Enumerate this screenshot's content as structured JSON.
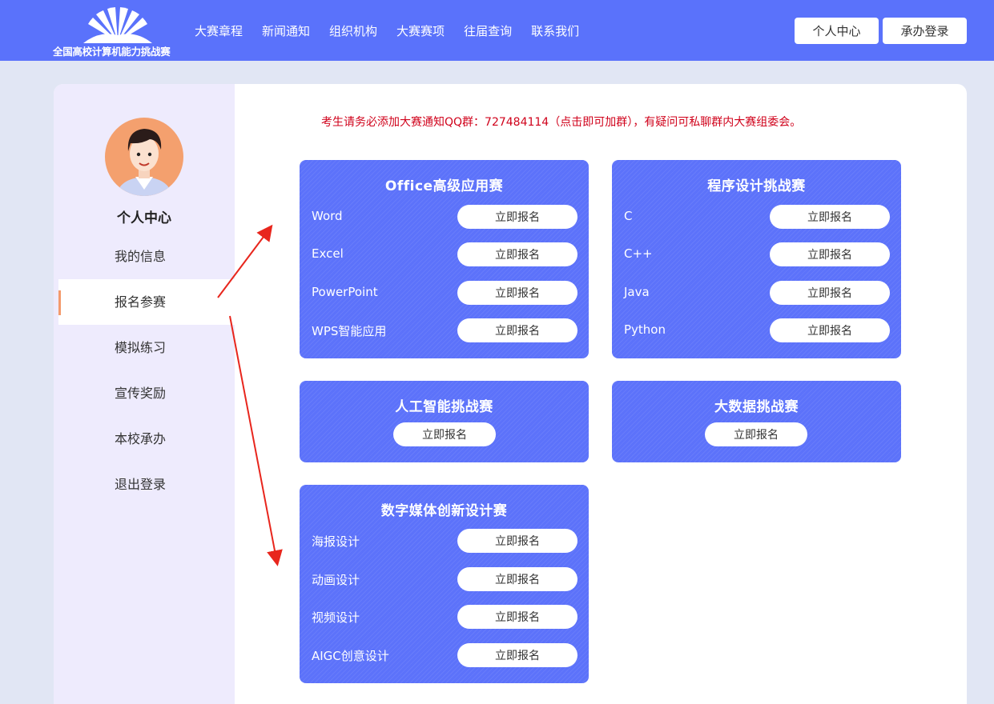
{
  "header": {
    "logo_text": "全国高校计算机能力挑战赛",
    "nav": [
      "大赛章程",
      "新闻通知",
      "组织机构",
      "大赛赛项",
      "往届查询",
      "联系我们"
    ],
    "personal_center_label": "个人中心",
    "host_login_label": "承办登录",
    "bg_color": "#5a72fb"
  },
  "sidebar": {
    "title": "个人中心",
    "items": [
      "我的信息",
      "报名参赛",
      "模拟练习",
      "宣传奖励",
      "本校承办",
      "退出登录"
    ],
    "active_index": 1
  },
  "notice": "考生请务必添加大赛通知QQ群：727484114（点击即可加群），有疑问可私聊群内大赛组委会。",
  "register_label": "立即报名",
  "cards": {
    "office": {
      "title": "Office高级应用赛",
      "rows": [
        "Word",
        "Excel",
        "PowerPoint",
        "WPS智能应用"
      ]
    },
    "programming": {
      "title": "程序设计挑战赛",
      "rows": [
        "C",
        "C++",
        "Java",
        "Python"
      ]
    },
    "ai": {
      "title": "人工智能挑战赛"
    },
    "bigdata": {
      "title": "大数据挑战赛"
    },
    "media": {
      "title": "数字媒体创新设计赛",
      "rows": [
        "海报设计",
        "动画设计",
        "视频设计",
        "AIGC创意设计"
      ]
    }
  },
  "colors": {
    "card": "#5c72fa",
    "notice": "#d0021b",
    "accent": "#f49a6c",
    "arrow": "#e8261d"
  }
}
